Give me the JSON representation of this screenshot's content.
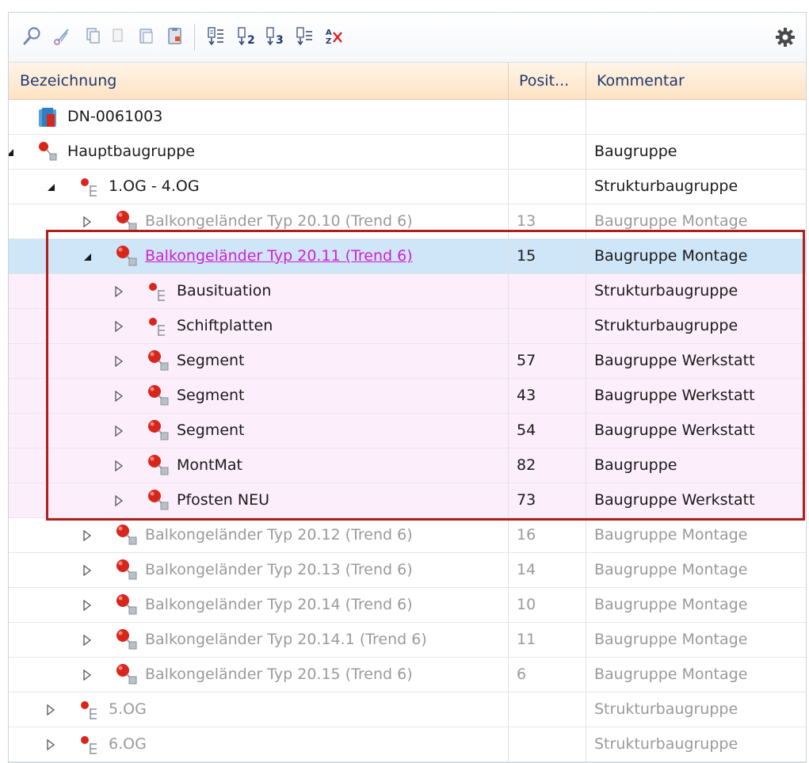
{
  "toolbar": {
    "buttons": [
      {
        "name": "search-icon"
      },
      {
        "name": "cut-icon"
      },
      {
        "name": "copy-icon"
      },
      {
        "name": "copy-disabled-icon"
      },
      {
        "name": "paste-icon"
      },
      {
        "name": "paste-special-icon"
      },
      {
        "name": "sort-1-icon"
      },
      {
        "name": "sort-2-icon"
      },
      {
        "name": "sort-3-icon"
      },
      {
        "name": "sort-4-icon"
      },
      {
        "name": "clear-sort-icon"
      }
    ],
    "settings_icon": "gear-icon"
  },
  "columns": {
    "name": "Bezeichnung",
    "position": "Posit...",
    "comment": "Kommentar"
  },
  "colors": {
    "header_gradient_top": "#fff5e8",
    "header_gradient_bottom": "#fde2c4",
    "selected_row": "#cfe5f8",
    "child_rows": "#fdeefb",
    "highlight_frame": "#b01e1e",
    "link_text": "#d31fd3"
  },
  "rows": [
    {
      "label": "DN-0061003",
      "pos": "",
      "comment": "",
      "level": 0,
      "icon": "project-folder-icon",
      "arrow": "none",
      "style": "norm",
      "bg": ""
    },
    {
      "label": "Hauptbaugruppe",
      "pos": "",
      "comment": "Baugruppe",
      "level": 0,
      "icon": "assembly-main-icon",
      "arrow": "expanded",
      "style": "norm",
      "bg": ""
    },
    {
      "label": "1.OG - 4.OG",
      "pos": "",
      "comment": "Strukturbaugruppe",
      "level": 1,
      "icon": "structure-icon",
      "arrow": "expanded",
      "style": "norm",
      "bg": ""
    },
    {
      "label": "Balkongeländer Typ 20.10 (Trend 6)",
      "pos": "13",
      "comment": "Baugruppe Montage",
      "level": 2,
      "icon": "assembly-icon",
      "arrow": "collapsed",
      "style": "dim",
      "bg": ""
    },
    {
      "label": "Balkongeländer Typ 20.11 (Trend 6)",
      "pos": "15",
      "comment": "Baugruppe Montage",
      "level": 2,
      "icon": "assembly-icon",
      "arrow": "expanded",
      "style": "link",
      "bg": "sel"
    },
    {
      "label": "Bausituation",
      "pos": "",
      "comment": "Strukturbaugruppe",
      "level": 3,
      "icon": "structure-icon",
      "arrow": "collapsed",
      "style": "norm",
      "bg": "sub"
    },
    {
      "label": "Schiftplatten",
      "pos": "",
      "comment": "Strukturbaugruppe",
      "level": 3,
      "icon": "structure-icon",
      "arrow": "collapsed",
      "style": "norm",
      "bg": "sub"
    },
    {
      "label": "Segment",
      "pos": "57",
      "comment": "Baugruppe Werkstatt",
      "level": 3,
      "icon": "assembly-icon",
      "arrow": "collapsed",
      "style": "norm",
      "bg": "sub"
    },
    {
      "label": "Segment",
      "pos": "43",
      "comment": "Baugruppe Werkstatt",
      "level": 3,
      "icon": "assembly-icon",
      "arrow": "collapsed",
      "style": "norm",
      "bg": "sub"
    },
    {
      "label": "Segment",
      "pos": "54",
      "comment": "Baugruppe Werkstatt",
      "level": 3,
      "icon": "assembly-icon",
      "arrow": "collapsed",
      "style": "norm",
      "bg": "sub"
    },
    {
      "label": "MontMat",
      "pos": "82",
      "comment": "Baugruppe",
      "level": 3,
      "icon": "assembly-icon",
      "arrow": "collapsed",
      "style": "norm",
      "bg": "sub"
    },
    {
      "label": "Pfosten NEU",
      "pos": "73",
      "comment": "Baugruppe Werkstatt",
      "level": 3,
      "icon": "assembly-icon",
      "arrow": "collapsed",
      "style": "norm",
      "bg": "sub"
    },
    {
      "label": "Balkongeländer Typ 20.12 (Trend 6)",
      "pos": "16",
      "comment": "Baugruppe Montage",
      "level": 2,
      "icon": "assembly-icon",
      "arrow": "collapsed",
      "style": "dim",
      "bg": ""
    },
    {
      "label": "Balkongeländer Typ 20.13 (Trend 6)",
      "pos": "14",
      "comment": "Baugruppe Montage",
      "level": 2,
      "icon": "assembly-icon",
      "arrow": "collapsed",
      "style": "dim",
      "bg": ""
    },
    {
      "label": "Balkongeländer Typ 20.14 (Trend 6)",
      "pos": "10",
      "comment": "Baugruppe Montage",
      "level": 2,
      "icon": "assembly-icon",
      "arrow": "collapsed",
      "style": "dim",
      "bg": ""
    },
    {
      "label": "Balkongeländer Typ 20.14.1 (Trend 6)",
      "pos": "11",
      "comment": "Baugruppe Montage",
      "level": 2,
      "icon": "assembly-icon",
      "arrow": "collapsed",
      "style": "dim",
      "bg": ""
    },
    {
      "label": "Balkongeländer Typ 20.15 (Trend 6)",
      "pos": "6",
      "comment": "Baugruppe Montage",
      "level": 2,
      "icon": "assembly-icon",
      "arrow": "collapsed",
      "style": "dim",
      "bg": ""
    },
    {
      "label": "5.OG",
      "pos": "",
      "comment": "Strukturbaugruppe",
      "level": 1,
      "icon": "structure-icon",
      "arrow": "collapsed",
      "style": "dim",
      "bg": ""
    },
    {
      "label": "6.OG",
      "pos": "",
      "comment": "Strukturbaugruppe",
      "level": 1,
      "icon": "structure-icon",
      "arrow": "collapsed",
      "style": "dim",
      "bg": ""
    }
  ]
}
